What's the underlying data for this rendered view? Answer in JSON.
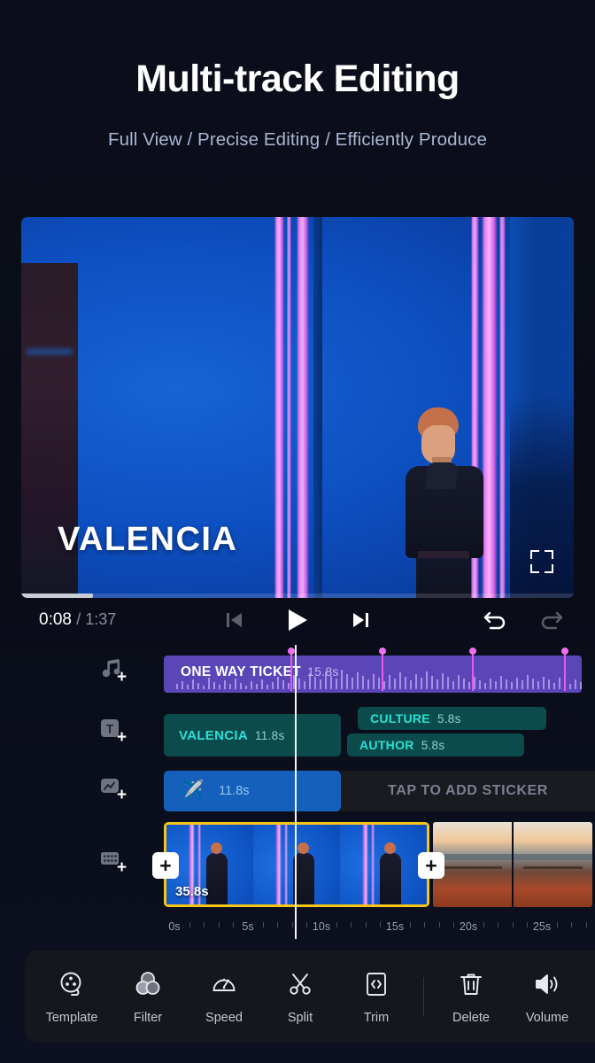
{
  "header": {
    "title": "Multi-track Editing",
    "subtitle": "Full View / Precise Editing / Efficiently Produce"
  },
  "preview": {
    "overlay_text": "VALENCIA",
    "fullscreen_icon": "fullscreen-icon",
    "progress_percent": 13
  },
  "controls": {
    "current_time": "0:08",
    "total_time": "/ 1:37",
    "prev_icon": "skip-previous-icon",
    "play_icon": "play-icon",
    "next_icon": "skip-next-icon",
    "undo_icon": "undo-icon",
    "redo_icon": "redo-icon"
  },
  "timeline": {
    "playhead_time": "0:08",
    "tracks": [
      {
        "type": "audio",
        "icon": "add-music-icon",
        "clip": {
          "label": "ONE WAY TICKET",
          "duration": "15.8s"
        },
        "markers": 4
      },
      {
        "type": "text",
        "icon": "add-text-icon",
        "clips": [
          {
            "label": "VALENCIA",
            "duration": "11.8s"
          },
          {
            "label": "CULTURE",
            "duration": "5.8s"
          },
          {
            "label": "AUTHOR",
            "duration": "5.8s"
          }
        ]
      },
      {
        "type": "sticker",
        "icon": "add-sticker-icon",
        "clip": {
          "emoji": "✈️",
          "duration": "11.8s"
        },
        "placeholder": "TAP TO ADD STICKER"
      },
      {
        "type": "video",
        "icon": "add-video-icon",
        "clip": {
          "duration": "35.8s",
          "selected": true
        },
        "transition_label": "+"
      }
    ],
    "ruler_labels": [
      "0s",
      "5s",
      "10s",
      "15s",
      "20s",
      "25s"
    ]
  },
  "toolbar": {
    "items": [
      {
        "label": "Template",
        "icon": "film-reel-icon"
      },
      {
        "label": "Filter",
        "icon": "filter-circles-icon"
      },
      {
        "label": "Speed",
        "icon": "speedometer-icon"
      },
      {
        "label": "Split",
        "icon": "scissors-icon"
      },
      {
        "label": "Trim",
        "icon": "trim-brackets-icon"
      },
      {
        "label": "Delete",
        "icon": "trash-icon"
      },
      {
        "label": "Volume",
        "icon": "speaker-icon"
      }
    ]
  },
  "colors": {
    "background": "#0b0e1a",
    "accent_yellow": "#f5c518",
    "audio_clip": "#5b46b8",
    "text_clip": "#0b4b4c",
    "text_clip_fg": "#2ae0d6",
    "sticker_clip": "#1560ba",
    "marker": "#e75ae8"
  }
}
